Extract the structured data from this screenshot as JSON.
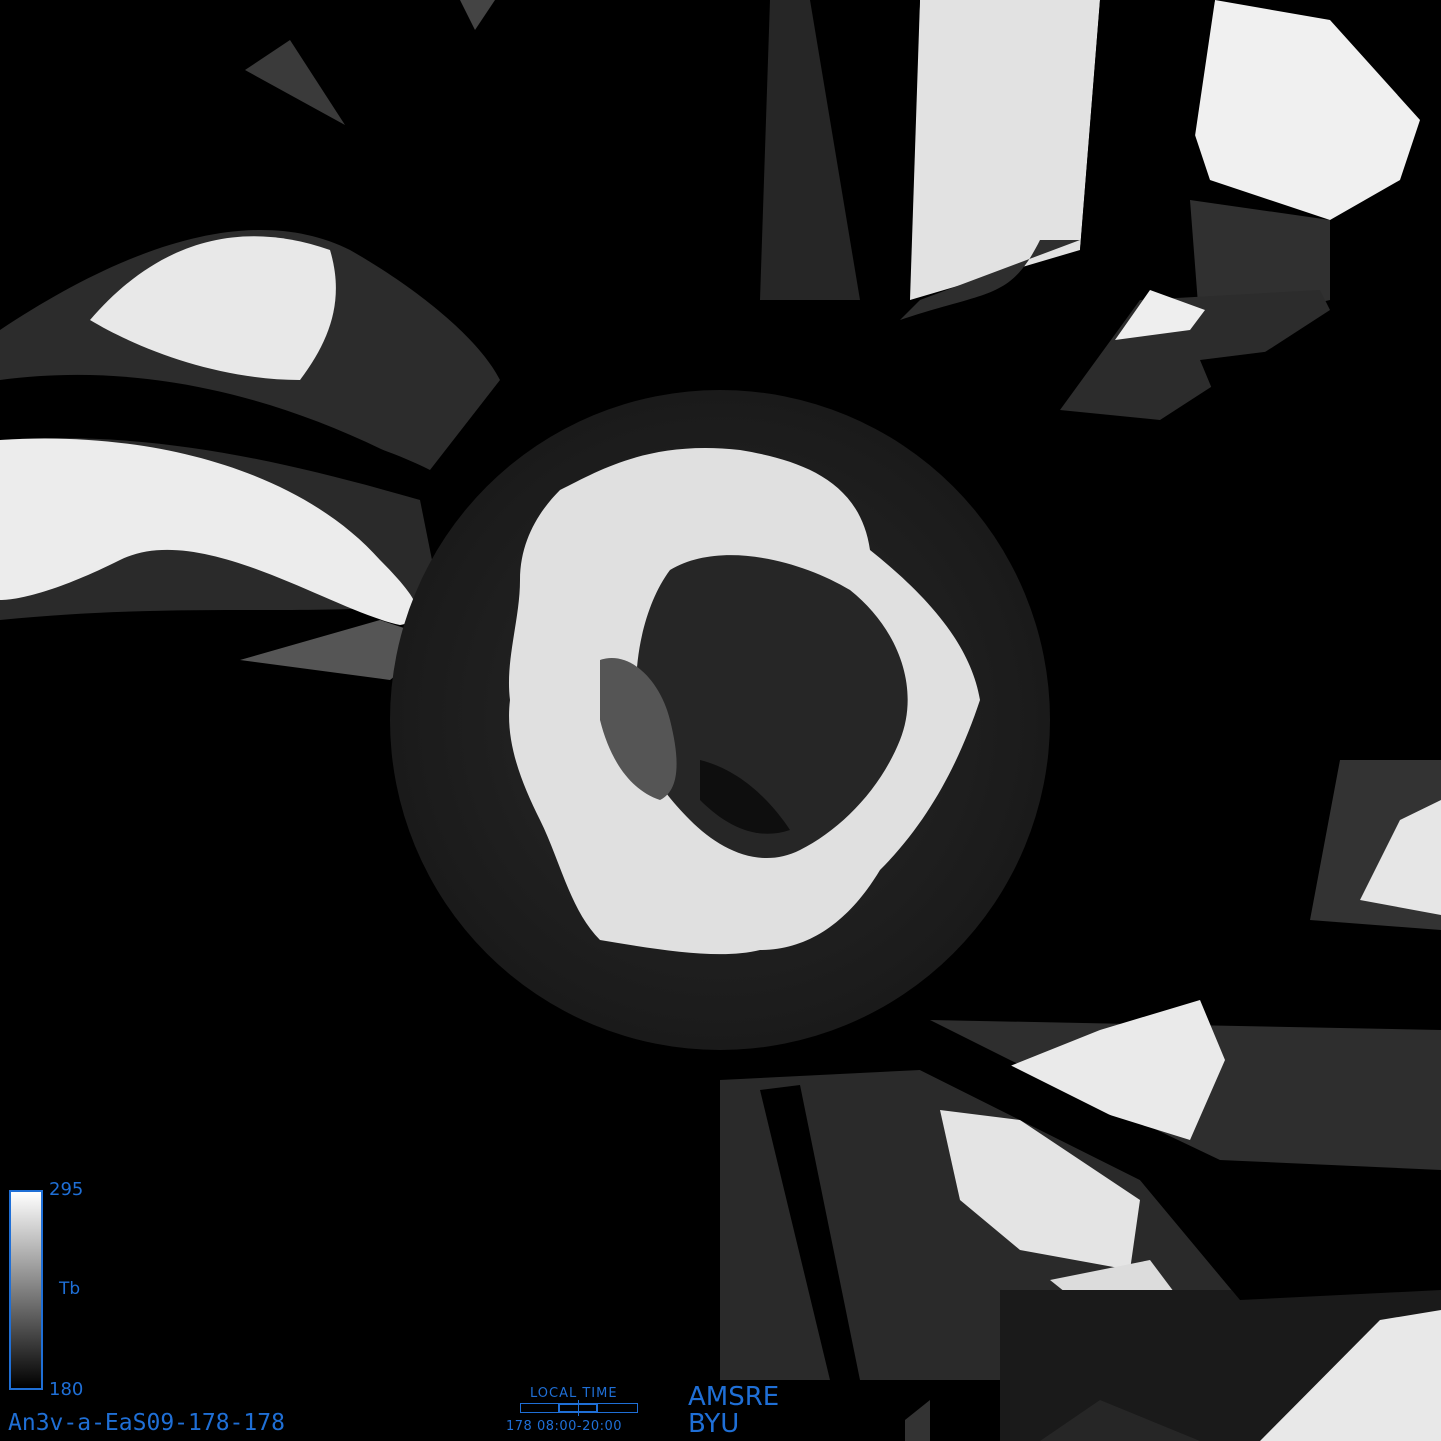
{
  "colorbar": {
    "max_label": "295",
    "min_label": "180",
    "variable_label": "Tb",
    "gradient_top_color": "#ffffff",
    "gradient_bottom_color": "#000000"
  },
  "image_id": "An3v-a-EaS09-178-178",
  "local_time": {
    "title": "LOCAL TIME",
    "range_label": "178 08:00-20:00"
  },
  "sensor": "AMSRE",
  "organization": "BYU",
  "colors": {
    "background": "#000000",
    "label_blue": "#1f6fd6",
    "land_bright": "#e6e6e6",
    "ocean_dark": "#222222"
  },
  "icons": {
    "polar_map": "antarctica-polar-brightness-temperature-map"
  }
}
